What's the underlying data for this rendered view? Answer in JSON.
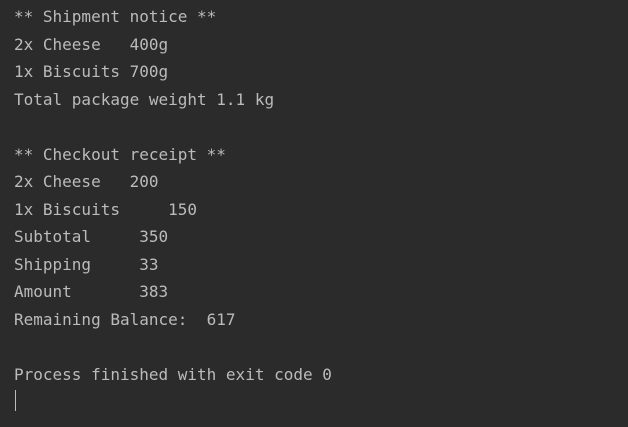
{
  "console": {
    "lines": [
      "** Shipment notice **",
      "2x Cheese   400g",
      "1x Biscuits 700g",
      "Total package weight 1.1 kg",
      "",
      "** Checkout receipt **",
      "2x Cheese   200",
      "1x Biscuits     150",
      "Subtotal     350",
      "Shipping     33",
      "Amount       383",
      "Remaining Balance:  617",
      "",
      "Process finished with exit code 0"
    ]
  },
  "colors": {
    "background": "#2b2b2b",
    "text": "#bbbbbb"
  }
}
